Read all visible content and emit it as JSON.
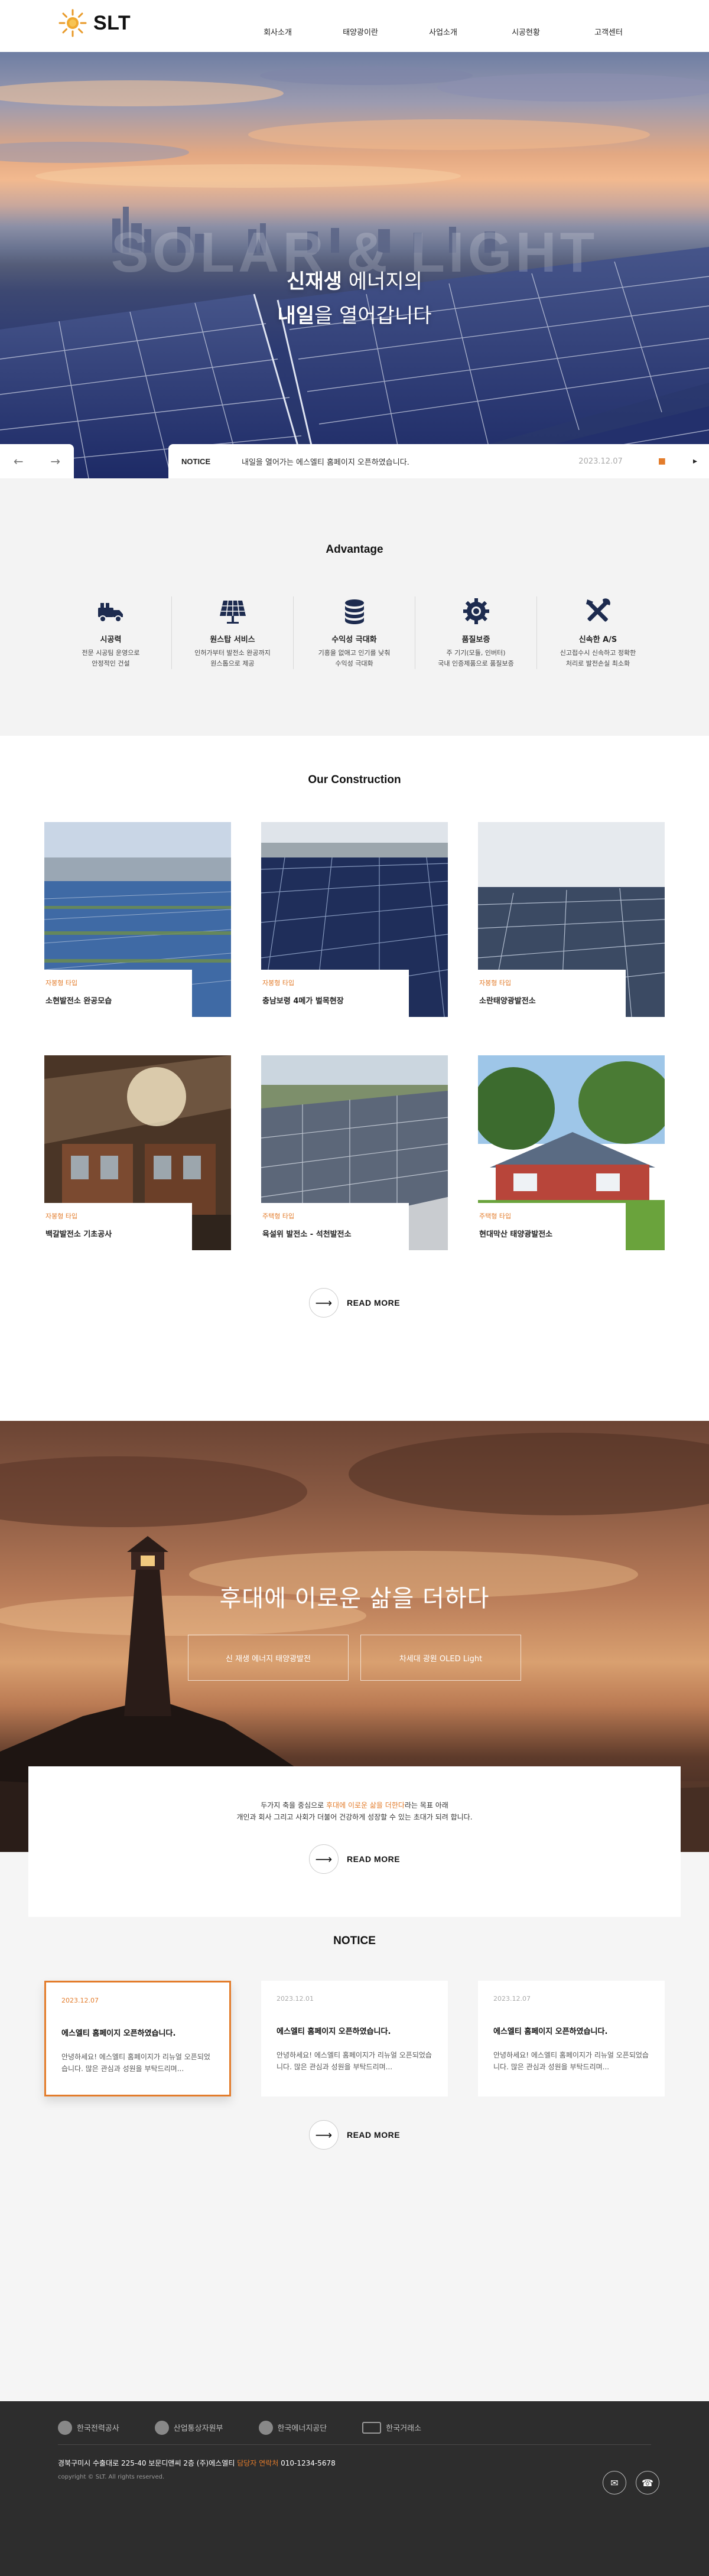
{
  "brand": {
    "name": "SLT"
  },
  "nav": [
    "회사소개",
    "태양광이란",
    "사업소개",
    "시공현황",
    "고객센터"
  ],
  "hero": {
    "big_word": "SOLAR & LIGHT",
    "line1_strong": "신재생",
    "line1_rest": " 에너지의",
    "line2_strong": "내일",
    "line2_rest": "을 열어갑니다"
  },
  "notice_bar": {
    "prev": "←",
    "next": "→",
    "label": "NOTICE",
    "text": "내일을 열어가는 에스엘티 홈페이지 오픈하였습니다.",
    "date": "2023.12.07",
    "pause": "■",
    "play": "▸"
  },
  "advantage": {
    "title": "Advantage",
    "items": [
      {
        "icon": "truck-icon",
        "name": "시공력",
        "desc1": "전문 시공팀 운영으로",
        "desc2": "안정적인 건설"
      },
      {
        "icon": "solar-panel-icon",
        "name": "원스탑 서비스",
        "desc1": "인허가부터 발전소 완공까지",
        "desc2": "원스톱으로 제공"
      },
      {
        "icon": "coins-icon",
        "name": "수익성 극대화",
        "desc1": "기흥을 없애고 인기를 낮춰",
        "desc2": "수익성 극대화"
      },
      {
        "icon": "gear-badge-icon",
        "name": "품질보증",
        "desc1": "주 기기(모듈, 인버터)",
        "desc2": "국내 인증제품으로 품질보증"
      },
      {
        "icon": "tools-icon",
        "name": "신속한 A/S",
        "desc1": "신고접수시 신속하고 정확한",
        "desc2": "처리로 발전손실 최소화"
      }
    ]
  },
  "construction": {
    "title": "Our Construction",
    "items": [
      {
        "cat": "자봉형 타입",
        "title": "소현발전소 완공모습"
      },
      {
        "cat": "자봉형 타입",
        "title": "충남보령 4메가 벌목현장"
      },
      {
        "cat": "자봉형 타입",
        "title": "소란태양광발전소"
      },
      {
        "cat": "자봉형 타입",
        "title": "백갈발전소 기초공사"
      },
      {
        "cat": "주택형 타입",
        "title": "육설위 발전소 - 석천발전소"
      },
      {
        "cat": "주택형 타입",
        "title": "현대막산 태양광발전소"
      }
    ],
    "readmore": "READ MORE",
    "arrow": "⟶"
  },
  "lighthouse": {
    "headline": "후대에 이로운 삶을 더하다",
    "btn1": "신 재생 에너지 태양광발전",
    "btn2": "차세대 광원 OLED Light",
    "line1_a": "두가지 축을 중심으로 ",
    "line1_hl": "후대에 이로운 삶을 더한다",
    "line1_b": "라는 목표 아래",
    "line2": "개인과 회사 그리고 사회가 더불어 건강하게 성장할 수 있는 초대가 되려 합니다.",
    "readmore": "READ MORE",
    "arrow": "⟶"
  },
  "notice": {
    "title": "NOTICE",
    "items": [
      {
        "date": "2023.12.07",
        "title": "에스엘티 홈페이지 오픈하였습니다.",
        "body": "안녕하세요! 에스엘티 홈페이지가 리뉴얼 오픈되었습니다. 많은 관심과 성원을 부탁드리며..."
      },
      {
        "date": "2023.12.01",
        "title": "에스엘티 홈페이지 오픈하였습니다.",
        "body": "안녕하세요! 에스엘티 홈페이지가 리뉴얼 오픈되었습니다. 많은 관심과 성원을 부탁드리며..."
      },
      {
        "date": "2023.12.07",
        "title": "에스엘티 홈페이지 오픈하였습니다.",
        "body": "안녕하세요! 에스엘티 홈페이지가 리뉴얼 오픈되었습니다. 많은 관심과 성원을 부탁드리며..."
      }
    ],
    "readmore": "READ MORE",
    "arrow": "⟶"
  },
  "footer": {
    "partners": [
      "한국전력공사",
      "산업통상자원부",
      "한국에너지공단",
      "한국거래소"
    ],
    "addr_a": "경북구미시 수출대로 225-40 보문디앤씨 2층 (주)에스엘티 ",
    "addr_hl": "담당자 연락처",
    "addr_b": " 010-1234-5678",
    "copy": "copyright © SLT. All rights reserved.",
    "icon_mail": "✉",
    "icon_chat": "☎"
  },
  "colors": {
    "accent": "#e37c2b",
    "footer_bg": "#2d2d2d",
    "section_bg": "#f3f3f3"
  }
}
